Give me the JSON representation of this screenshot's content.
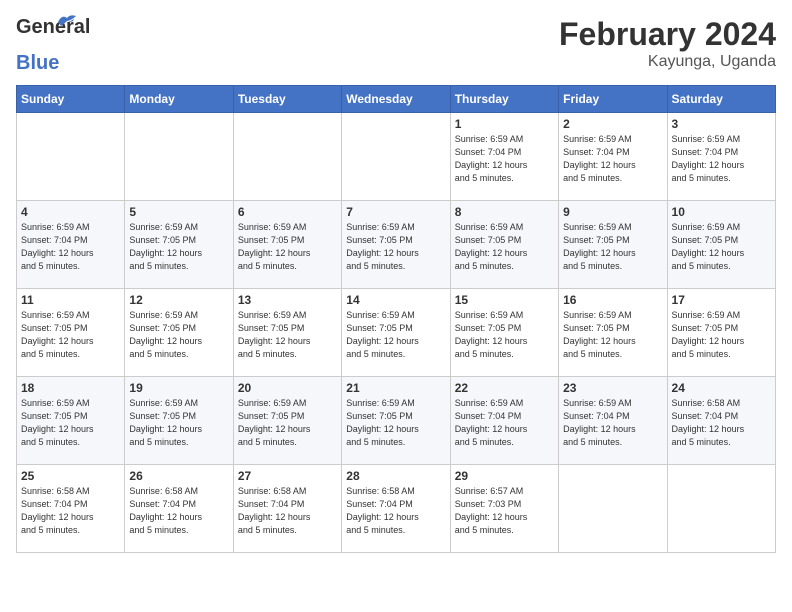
{
  "header": {
    "logo_line1": "General",
    "logo_line2": "Blue",
    "month_year": "February 2024",
    "location": "Kayunga, Uganda"
  },
  "weekdays": [
    "Sunday",
    "Monday",
    "Tuesday",
    "Wednesday",
    "Thursday",
    "Friday",
    "Saturday"
  ],
  "weeks": [
    [
      {
        "day": "",
        "info": ""
      },
      {
        "day": "",
        "info": ""
      },
      {
        "day": "",
        "info": ""
      },
      {
        "day": "",
        "info": ""
      },
      {
        "day": "1",
        "info": "Sunrise: 6:59 AM\nSunset: 7:04 PM\nDaylight: 12 hours\nand 5 minutes."
      },
      {
        "day": "2",
        "info": "Sunrise: 6:59 AM\nSunset: 7:04 PM\nDaylight: 12 hours\nand 5 minutes."
      },
      {
        "day": "3",
        "info": "Sunrise: 6:59 AM\nSunset: 7:04 PM\nDaylight: 12 hours\nand 5 minutes."
      }
    ],
    [
      {
        "day": "4",
        "info": "Sunrise: 6:59 AM\nSunset: 7:04 PM\nDaylight: 12 hours\nand 5 minutes."
      },
      {
        "day": "5",
        "info": "Sunrise: 6:59 AM\nSunset: 7:05 PM\nDaylight: 12 hours\nand 5 minutes."
      },
      {
        "day": "6",
        "info": "Sunrise: 6:59 AM\nSunset: 7:05 PM\nDaylight: 12 hours\nand 5 minutes."
      },
      {
        "day": "7",
        "info": "Sunrise: 6:59 AM\nSunset: 7:05 PM\nDaylight: 12 hours\nand 5 minutes."
      },
      {
        "day": "8",
        "info": "Sunrise: 6:59 AM\nSunset: 7:05 PM\nDaylight: 12 hours\nand 5 minutes."
      },
      {
        "day": "9",
        "info": "Sunrise: 6:59 AM\nSunset: 7:05 PM\nDaylight: 12 hours\nand 5 minutes."
      },
      {
        "day": "10",
        "info": "Sunrise: 6:59 AM\nSunset: 7:05 PM\nDaylight: 12 hours\nand 5 minutes."
      }
    ],
    [
      {
        "day": "11",
        "info": "Sunrise: 6:59 AM\nSunset: 7:05 PM\nDaylight: 12 hours\nand 5 minutes."
      },
      {
        "day": "12",
        "info": "Sunrise: 6:59 AM\nSunset: 7:05 PM\nDaylight: 12 hours\nand 5 minutes."
      },
      {
        "day": "13",
        "info": "Sunrise: 6:59 AM\nSunset: 7:05 PM\nDaylight: 12 hours\nand 5 minutes."
      },
      {
        "day": "14",
        "info": "Sunrise: 6:59 AM\nSunset: 7:05 PM\nDaylight: 12 hours\nand 5 minutes."
      },
      {
        "day": "15",
        "info": "Sunrise: 6:59 AM\nSunset: 7:05 PM\nDaylight: 12 hours\nand 5 minutes."
      },
      {
        "day": "16",
        "info": "Sunrise: 6:59 AM\nSunset: 7:05 PM\nDaylight: 12 hours\nand 5 minutes."
      },
      {
        "day": "17",
        "info": "Sunrise: 6:59 AM\nSunset: 7:05 PM\nDaylight: 12 hours\nand 5 minutes."
      }
    ],
    [
      {
        "day": "18",
        "info": "Sunrise: 6:59 AM\nSunset: 7:05 PM\nDaylight: 12 hours\nand 5 minutes."
      },
      {
        "day": "19",
        "info": "Sunrise: 6:59 AM\nSunset: 7:05 PM\nDaylight: 12 hours\nand 5 minutes."
      },
      {
        "day": "20",
        "info": "Sunrise: 6:59 AM\nSunset: 7:05 PM\nDaylight: 12 hours\nand 5 minutes."
      },
      {
        "day": "21",
        "info": "Sunrise: 6:59 AM\nSunset: 7:05 PM\nDaylight: 12 hours\nand 5 minutes."
      },
      {
        "day": "22",
        "info": "Sunrise: 6:59 AM\nSunset: 7:04 PM\nDaylight: 12 hours\nand 5 minutes."
      },
      {
        "day": "23",
        "info": "Sunrise: 6:59 AM\nSunset: 7:04 PM\nDaylight: 12 hours\nand 5 minutes."
      },
      {
        "day": "24",
        "info": "Sunrise: 6:58 AM\nSunset: 7:04 PM\nDaylight: 12 hours\nand 5 minutes."
      }
    ],
    [
      {
        "day": "25",
        "info": "Sunrise: 6:58 AM\nSunset: 7:04 PM\nDaylight: 12 hours\nand 5 minutes."
      },
      {
        "day": "26",
        "info": "Sunrise: 6:58 AM\nSunset: 7:04 PM\nDaylight: 12 hours\nand 5 minutes."
      },
      {
        "day": "27",
        "info": "Sunrise: 6:58 AM\nSunset: 7:04 PM\nDaylight: 12 hours\nand 5 minutes."
      },
      {
        "day": "28",
        "info": "Sunrise: 6:58 AM\nSunset: 7:04 PM\nDaylight: 12 hours\nand 5 minutes."
      },
      {
        "day": "29",
        "info": "Sunrise: 6:57 AM\nSunset: 7:03 PM\nDaylight: 12 hours\nand 5 minutes."
      },
      {
        "day": "",
        "info": ""
      },
      {
        "day": "",
        "info": ""
      }
    ]
  ]
}
